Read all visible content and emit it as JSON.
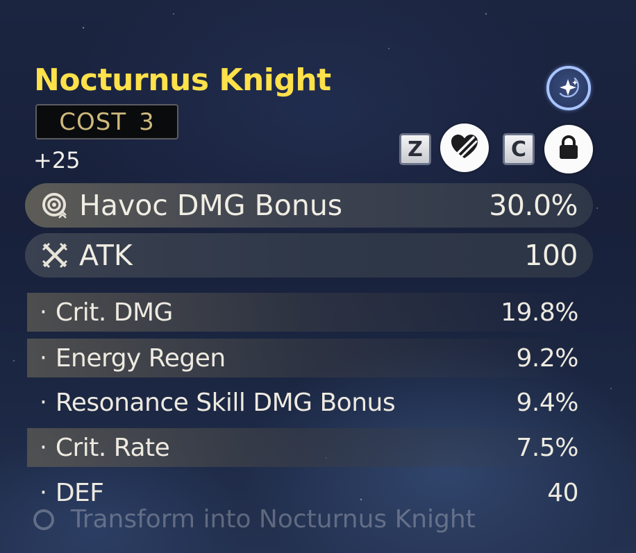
{
  "echo": {
    "name": "Nocturnus Knight",
    "cost_label": "COST",
    "cost_value": "3",
    "level": "+25"
  },
  "controls": {
    "discard_key": "Z",
    "lock_key": "C",
    "icons": {
      "sonata": "sparkle-icon",
      "discard": "heart-slash-icon",
      "lock": "lock-icon"
    }
  },
  "main_stats": [
    {
      "label": "Havoc DMG Bonus",
      "value": "30.0%",
      "icon": "havoc-icon"
    },
    {
      "label": "ATK",
      "value": "100",
      "icon": "crossed-swords-icon"
    }
  ],
  "sub_stats": [
    {
      "label": "Crit. DMG",
      "value": "19.8%",
      "shaded": true
    },
    {
      "label": "Energy Regen",
      "value": "9.2%",
      "shaded": true
    },
    {
      "label": "Resonance Skill DMG Bonus",
      "value": "9.4%",
      "shaded": false
    },
    {
      "label": "Crit. Rate",
      "value": "7.5%",
      "shaded": true
    },
    {
      "label": "DEF",
      "value": "40",
      "shaded": false
    }
  ],
  "bullet": "·",
  "skill_preview": "Transform into Nocturnus Knight",
  "colors": {
    "title": "#ffe14a",
    "cost_text": "#cdb97c",
    "badge_ring": "#a9c4ff"
  }
}
